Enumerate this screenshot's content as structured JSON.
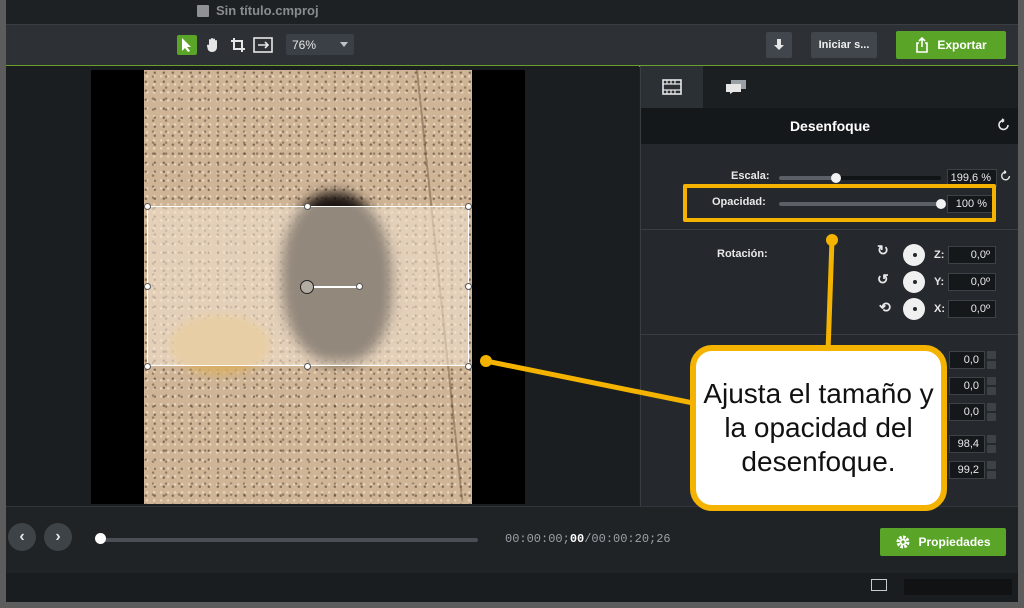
{
  "window": {
    "title": "Sin título.cmproj"
  },
  "toolbar": {
    "tools": [
      "pointer-tool",
      "hand-tool",
      "crop-tool",
      "pan-zoom-tool"
    ],
    "zoom_value": "76%",
    "signin_label": "Iniciar s...",
    "export_label": "Exportar"
  },
  "panel": {
    "tabs": [
      "visual-properties",
      "annotation-properties"
    ],
    "title": "Desenfoque",
    "scale": {
      "label": "Escala:",
      "value": "199,6 %",
      "level": 0.35
    },
    "opacity": {
      "label": "Opacidad:",
      "value": "100 %",
      "level": 1.0
    },
    "rotation": {
      "label": "Rotación:",
      "z": {
        "label": "Z:",
        "value": "0,0º"
      },
      "y": {
        "label": "Y:",
        "value": "0,0º"
      },
      "x": {
        "label": "X:",
        "value": "0,0º"
      }
    },
    "position_values": [
      "0,0",
      "0,0",
      "0,0",
      "98,4",
      "99,2"
    ]
  },
  "callout": {
    "text": "Ajusta el tamaño y la opacidad del desenfoque."
  },
  "playback": {
    "time_prefix": "00:00:00;",
    "time_bold": "00",
    "time_suffix": "/00:00:20;26",
    "progress": 0.0,
    "properties_label": "Propiedades"
  },
  "colors": {
    "accent_green": "#5aa428",
    "highlight_yellow": "#f3b300"
  }
}
